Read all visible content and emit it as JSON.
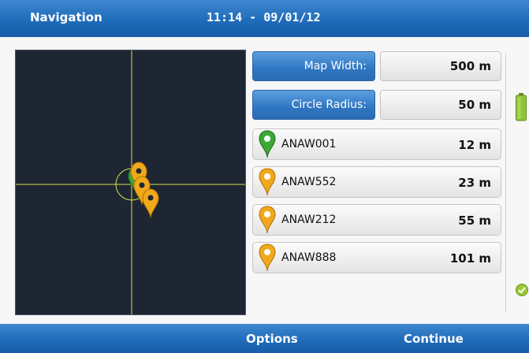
{
  "header": {
    "title": "Navigation",
    "datetime": "11:14 - 09/01/12"
  },
  "settings": {
    "map_width_label": "Map Width:",
    "map_width_value": "500 m",
    "circle_radius_label": "Circle Radius:",
    "circle_radius_value": "50 m"
  },
  "targets": [
    {
      "name": "ANAW001",
      "distance": "12 m",
      "color": "#3aa934"
    },
    {
      "name": "ANAW552",
      "distance": "23 m",
      "color": "#f0a81c"
    },
    {
      "name": "ANAW212",
      "distance": "55 m",
      "color": "#f0a81c"
    },
    {
      "name": "ANAW888",
      "distance": "101 m",
      "color": "#f0a81c"
    }
  ],
  "softkeys": {
    "left": "Options",
    "right": "Continue"
  },
  "status_icons": [
    "battery-icon",
    "check-icon"
  ],
  "colors": {
    "bar_blue": "#1f6cba",
    "map_bg": "#1e2633",
    "crosshair": "#d8e04a"
  }
}
